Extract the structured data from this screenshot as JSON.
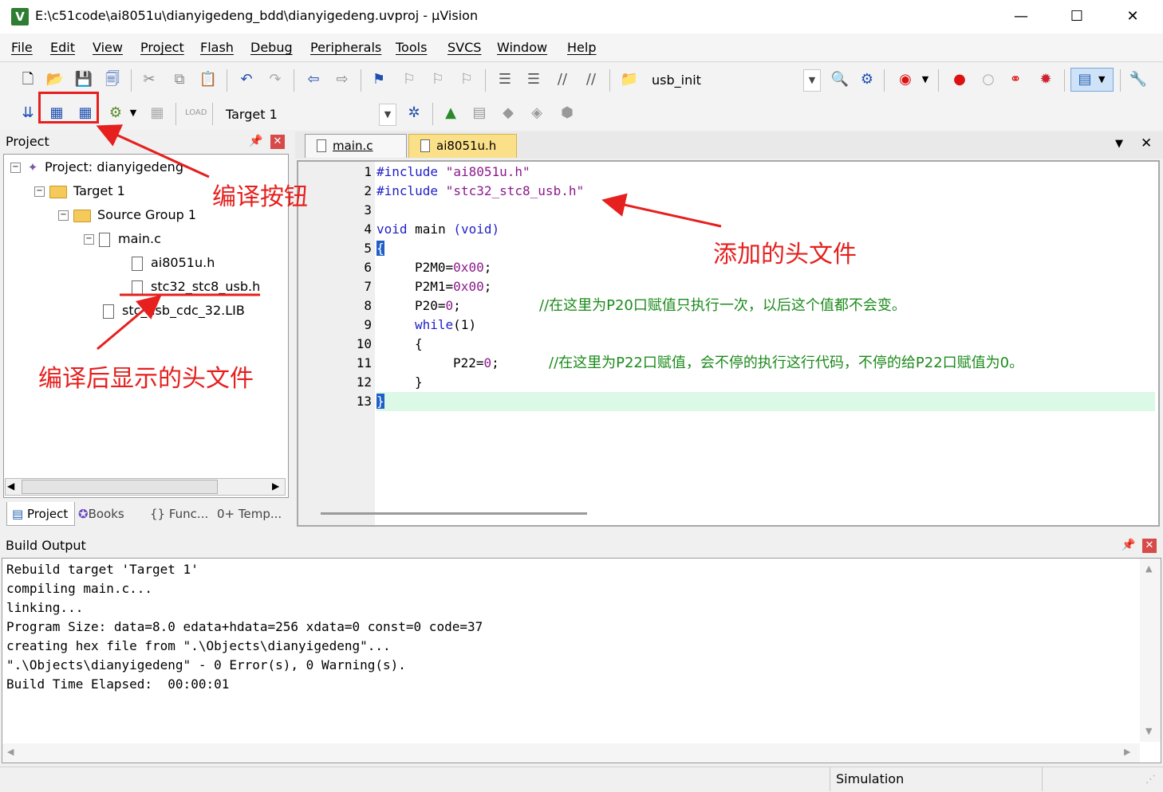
{
  "window": {
    "title": "E:\\c51code\\ai8051u\\dianyigedeng_bdd\\dianyigedeng.uvproj - µVision",
    "app_icon": "V",
    "controls": {
      "minimize": "—",
      "maximize": "☐",
      "close": "✕"
    }
  },
  "menu": [
    "File",
    "Edit",
    "View",
    "Project",
    "Flash",
    "Debug",
    "Peripherals",
    "Tools",
    "SVCS",
    "Window",
    "Help"
  ],
  "toolbar1": {
    "function_combo": "usb_init"
  },
  "toolbar2": {
    "target_combo": "Target 1"
  },
  "project_panel": {
    "title": "Project",
    "tree": {
      "project": "Project: dianyigedeng",
      "target": "Target 1",
      "group": "Source Group 1",
      "main_file": "main.c",
      "header1": "ai8051u.h",
      "header2": "stc32_stc8_usb.h",
      "lib": "stc_usb_cdc_32.LIB"
    },
    "tabs": [
      "Project",
      "Books",
      "{} Func...",
      "0+ Temp..."
    ]
  },
  "editor": {
    "tabs": [
      "main.c",
      "ai8051u.h"
    ],
    "active_tab": "main.c",
    "line_numbers": [
      "1",
      "2",
      "3",
      "4",
      "5",
      "6",
      "7",
      "8",
      "9",
      "10",
      "11",
      "12",
      "13"
    ],
    "lines": {
      "l1_pp": "#include",
      "l1_str": "\"ai8051u.h\"",
      "l2_pp": "#include",
      "l2_str": "\"stc32_stc8_usb.h\"",
      "l4_kw1": "void",
      "l4_mid": " main",
      "l4_kw2": "(void)",
      "l5": "{",
      "l6_a": "P2M0=",
      "l6_n": "0x00",
      "l6_b": ";",
      "l7_a": "P2M1=",
      "l7_n": "0x00",
      "l7_b": ";",
      "l8_a": "P20=",
      "l8_n": "0",
      "l8_b": ";",
      "l8_cmt": "//在这里为P20口赋值只执行一次，以后这个值都不会变。",
      "l9_kw": "while",
      "l9_rest": "(1)",
      "l10": "{",
      "l11_a": "P22=",
      "l11_n": "0",
      "l11_b": ";",
      "l11_cmt": "//在这里为P22口赋值，会不停的执行这行代码，不停的给P22口赋值为0。",
      "l12": "}",
      "l13": "}"
    }
  },
  "build_output": {
    "title": "Build Output",
    "lines": [
      "Rebuild target 'Target 1'",
      "compiling main.c...",
      "linking...",
      "Program Size: data=8.0 edata+hdata=256 xdata=0 const=0 code=37",
      "creating hex file from \".\\Objects\\dianyigedeng\"...",
      "\".\\Objects\\dianyigedeng\" - 0 Error(s), 0 Warning(s).",
      "Build Time Elapsed:  00:00:01"
    ]
  },
  "status": {
    "mode": "Simulation"
  },
  "annotations": {
    "compile_button": "编译按钮",
    "added_header": "添加的头文件",
    "header_after_compile": "编译后显示的头文件"
  },
  "colors": {
    "annotation": "#e5201e",
    "keyword": "#1f1fc8",
    "string": "#8b1a8b",
    "comment": "#1b8a1b"
  }
}
